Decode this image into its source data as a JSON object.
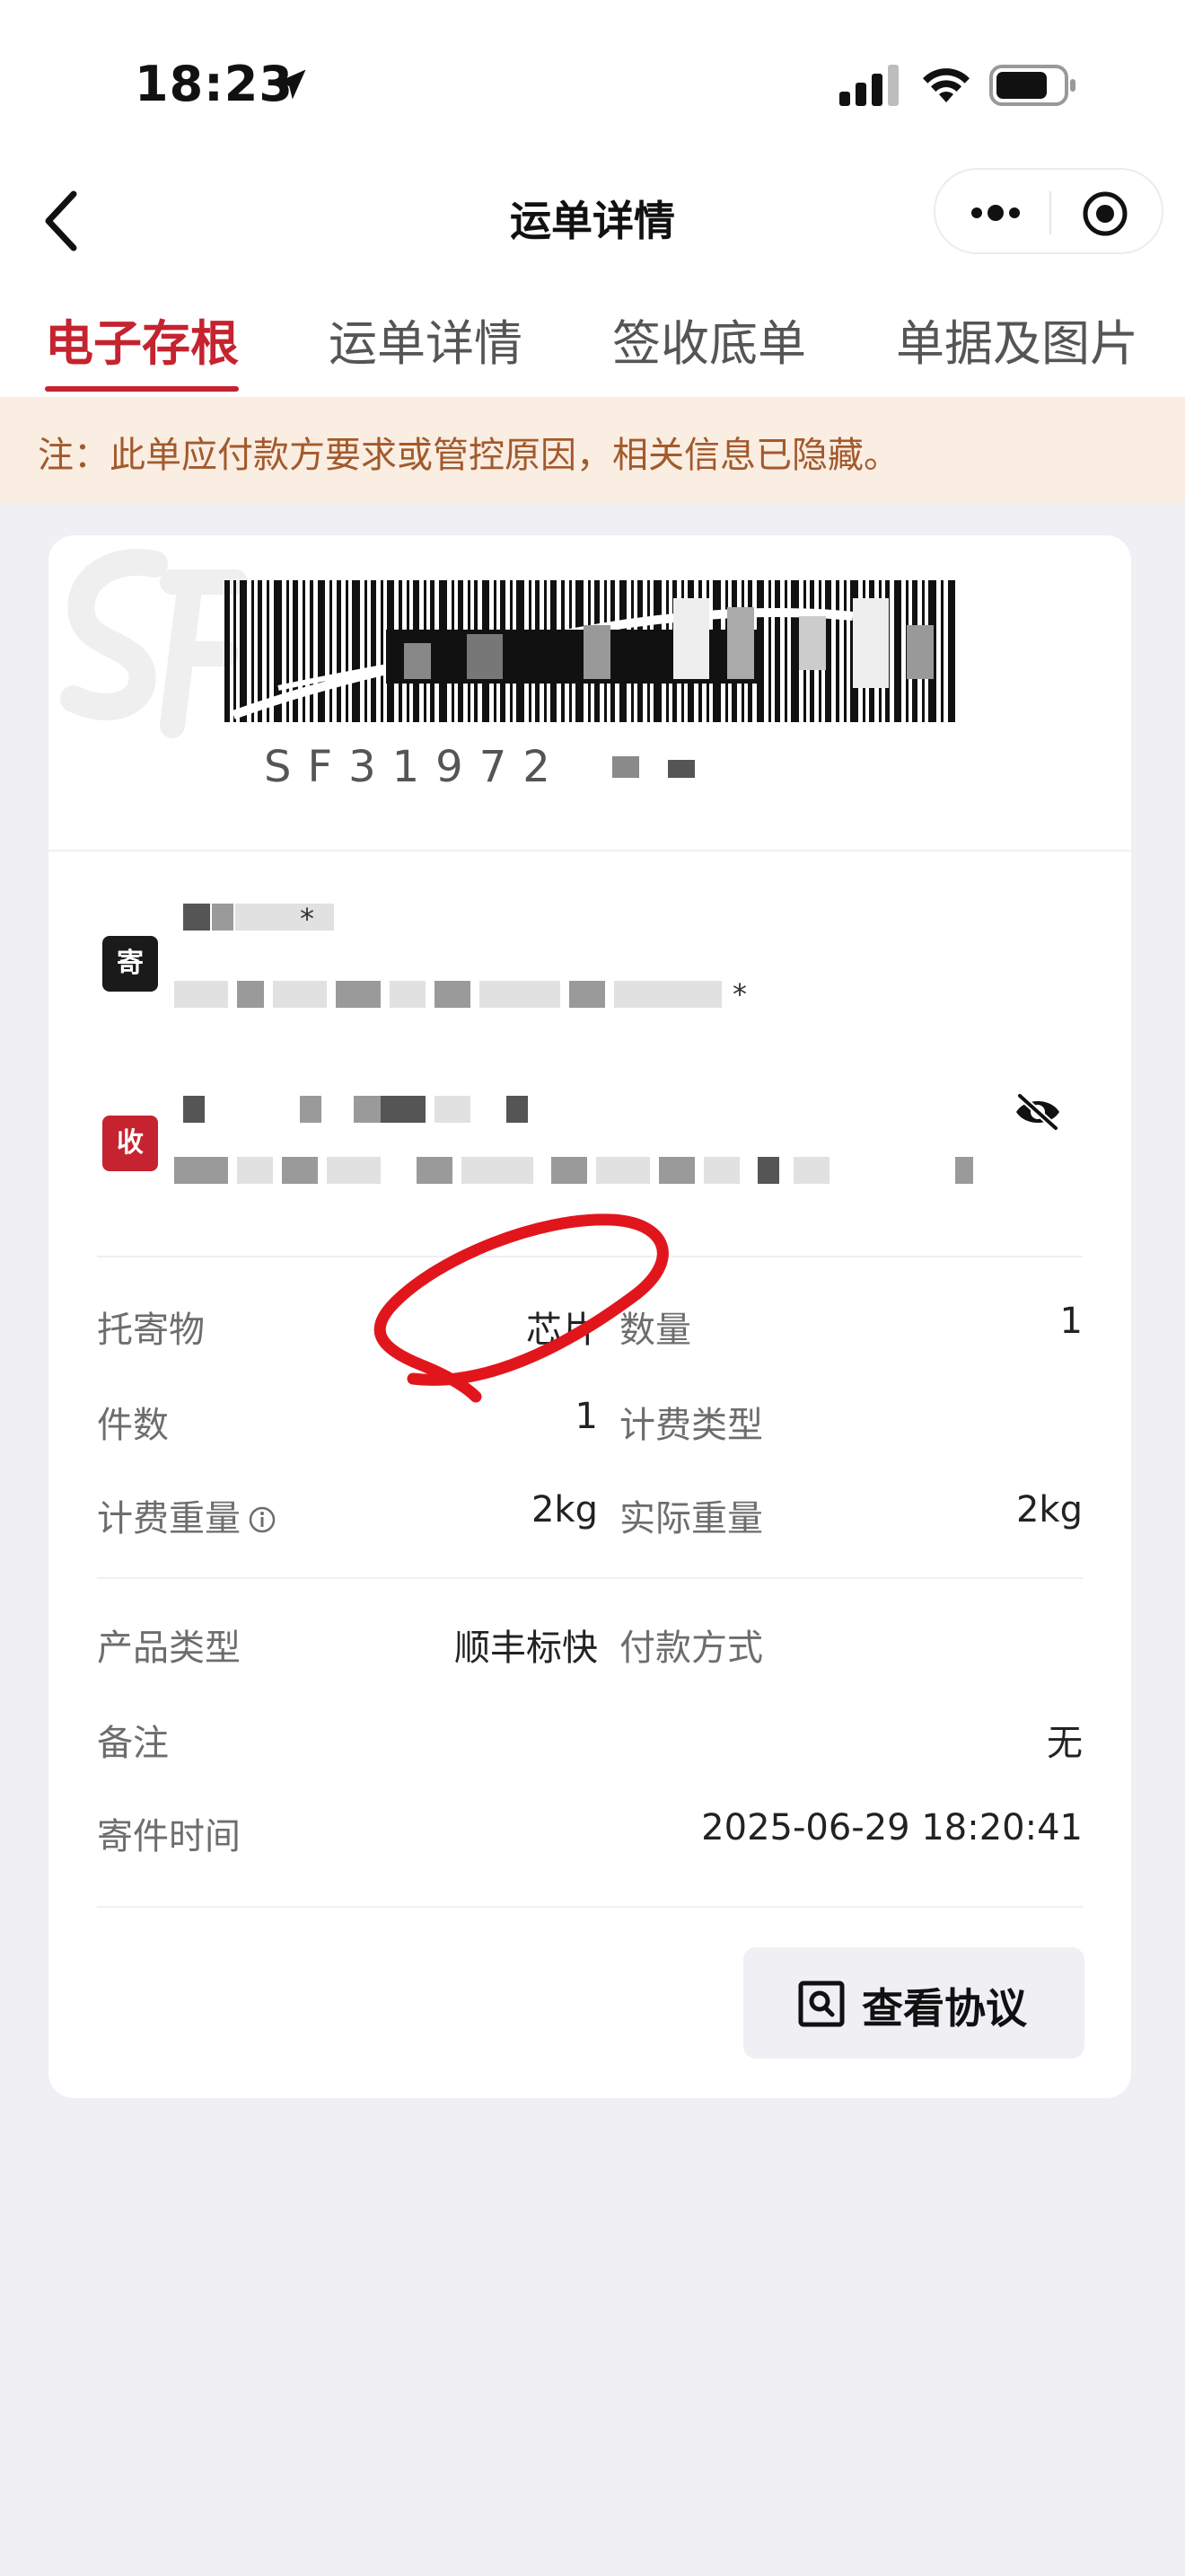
{
  "status_bar": {
    "time": "18:23"
  },
  "nav": {
    "title": "运单详情"
  },
  "tabs": [
    {
      "label": "电子存根",
      "active": true
    },
    {
      "label": "运单详情",
      "active": false
    },
    {
      "label": "签收底单",
      "active": false
    },
    {
      "label": "单据及图片",
      "active": false
    }
  ],
  "notice": {
    "text": "注：此单应付款方要求或管控原因，相关信息已隐藏。"
  },
  "waybill": {
    "number_visible": "SF31972",
    "sender_badge": "寄",
    "receiver_badge": "收",
    "sender_name_tail": "*",
    "sender_addr_tail": "*"
  },
  "fields": {
    "goods_label": "托寄物",
    "goods_value": "芯片",
    "quantity_label": "数量",
    "quantity_value": "1",
    "pieces_label": "件数",
    "pieces_value": "1",
    "billing_type_label": "计费类型",
    "billing_type_value": "",
    "billing_weight_label": "计费重量",
    "billing_weight_value": "2kg",
    "actual_weight_label": "实际重量",
    "actual_weight_value": "2kg",
    "product_type_label": "产品类型",
    "product_type_value": "顺丰标快",
    "payment_label": "付款方式",
    "payment_value": "",
    "remark_label": "备注",
    "remark_value": "无",
    "ship_time_label": "寄件时间",
    "ship_time_value": "2025-06-29 18:20:41"
  },
  "protocol_button": {
    "label": "查看协议"
  },
  "colors": {
    "accent": "#c5232f",
    "notice_bg": "#faede2",
    "notice_text": "#a25a2c",
    "page_bg": "#efeff4"
  },
  "icons": [
    "location-arrow-icon",
    "signal-icon",
    "wifi-icon",
    "battery-icon",
    "back-arrow-icon",
    "more-icon",
    "target-icon",
    "eye-hidden-icon",
    "info-icon",
    "search-document-icon"
  ]
}
